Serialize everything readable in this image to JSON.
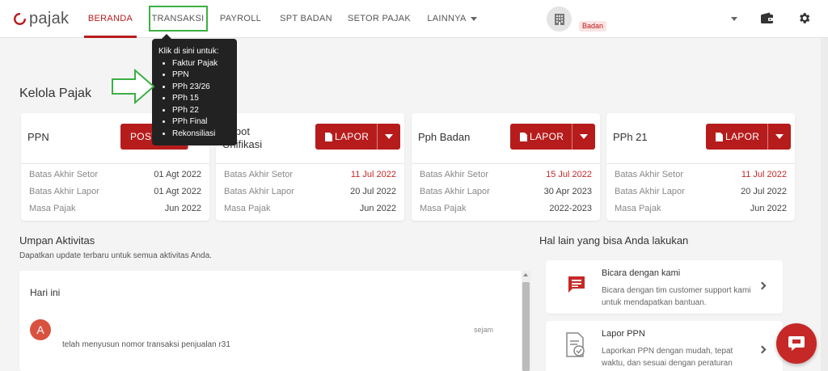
{
  "brand": {
    "logo_text": "pajak",
    "accent": "#b71c1c",
    "highlight": "#3cb043"
  },
  "nav": {
    "items": [
      {
        "label": "BERANDA"
      },
      {
        "label": "TRANSAKSI"
      },
      {
        "label": "PAYROLL"
      },
      {
        "label": "SPT BADAN"
      },
      {
        "label": "SETOR PAJAK"
      },
      {
        "label": "LAINNYA"
      }
    ],
    "company_badge": "Badan",
    "icons": [
      "building-icon",
      "chevron-down-icon",
      "wallet-icon",
      "gear-icon"
    ]
  },
  "tooltip": {
    "heading": "Klik di sini untuk:",
    "items": [
      "Faktur Pajak",
      "PPN",
      "PPh 23/26",
      "PPh 15",
      "PPh 22",
      "PPh Final",
      "Rekonsiliasi"
    ]
  },
  "kelola": {
    "title": "Kelola Pajak",
    "cards": [
      {
        "title": "PPN",
        "button": "POSTING",
        "rows": [
          {
            "label": "Batas Akhir Setor",
            "value": "01 Agt 2022",
            "red": false
          },
          {
            "label": "Batas Akhir Lapor",
            "value": "01 Agt 2022",
            "red": false
          },
          {
            "label": "Masa Pajak",
            "value": "Jun 2022",
            "red": false
          }
        ]
      },
      {
        "title_line1": "Bupot",
        "title_line2": "Unifikasi",
        "button": "LAPOR",
        "rows": [
          {
            "label": "Batas Akhir Setor",
            "value": "11 Jul 2022",
            "red": true
          },
          {
            "label": "Batas Akhir Lapor",
            "value": "20 Jul 2022",
            "red": false
          },
          {
            "label": "Masa Pajak",
            "value": "Jun 2022",
            "red": false
          }
        ]
      },
      {
        "title": "Pph Badan",
        "button": "LAPOR",
        "rows": [
          {
            "label": "Batas Akhir Setor",
            "value": "15 Jul 2022",
            "red": true
          },
          {
            "label": "Batas Akhir Lapor",
            "value": "30 Apr 2023",
            "red": false
          },
          {
            "label": "Masa Pajak",
            "value": "2022-2023",
            "red": false
          }
        ]
      },
      {
        "title": "PPh 21",
        "button": "LAPOR",
        "rows": [
          {
            "label": "Batas Akhir Setor",
            "value": "11 Jul 2022",
            "red": true
          },
          {
            "label": "Batas Akhir Lapor",
            "value": "20 Jul 2022",
            "red": false
          },
          {
            "label": "Masa Pajak",
            "value": "Jun 2022",
            "red": false
          }
        ]
      }
    ]
  },
  "activity": {
    "title": "Umpan Aktivitas",
    "subtitle": "Dapatkan update terbaru untuk semua aktivitas Anda.",
    "day_label": "Hari ini",
    "entries": [
      {
        "avatar": "A",
        "text": "telah menyusun nomor transaksi penjualan r31",
        "time": "sejam"
      }
    ]
  },
  "other": {
    "title": "Hal lain yang bisa Anda lakukan",
    "items": [
      {
        "title": "Bicara dengan kami",
        "desc": "Bicara dengan tim customer support kami untuk mendapatkan bantuan.",
        "icon": "chat-icon"
      },
      {
        "title": "Lapor PPN",
        "desc": "Laporkan PPN dengan mudah, tepat waktu, dan sesuai dengan peraturan terbaru.",
        "icon": "document-check-icon"
      }
    ]
  },
  "fab": {
    "icon": "chat-bubble-icon"
  }
}
